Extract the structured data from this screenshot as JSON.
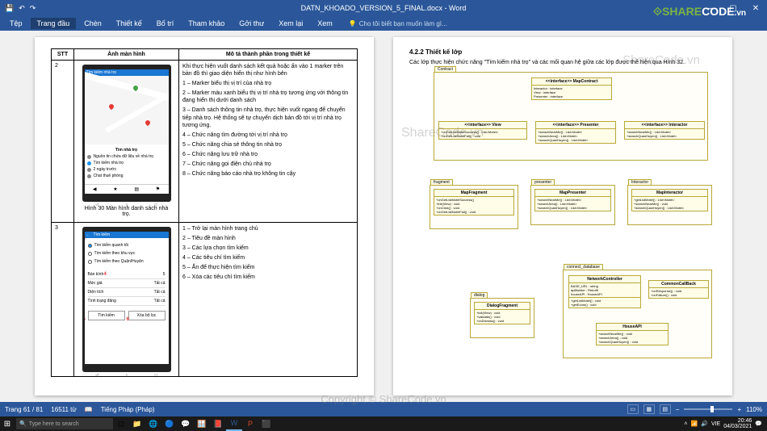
{
  "app": {
    "title": "DATN_KHOADO_VERSION_5_FINAL.docx - Word",
    "win_min": "—",
    "win_max": "▢",
    "win_close": "✕"
  },
  "ribbon": {
    "tabs": [
      "Tệp",
      "Trang đầu",
      "Chèn",
      "Thiết kế",
      "Bố trí",
      "Tham khảo",
      "Gởi thư",
      "Xem lại",
      "Xem"
    ],
    "tellme": "Cho tôi biết bạn muốn làm gì..."
  },
  "logo": {
    "share": "SHARE",
    "code": "CODE",
    "suffix": ".vn"
  },
  "watermarks": {
    "wm1": "ShareCode.vn",
    "wm2": "ShareCode.vn",
    "copyright": "Copyright © ShareCode.vn"
  },
  "page1": {
    "headers": {
      "stt": "STT",
      "img": "Ảnh màn hình",
      "desc": "Mô tả thành phần trong thiết kế"
    },
    "row2": {
      "stt": "2",
      "caption": "Hình 30 Màn hình danh sách nhà trọ.",
      "phone": {
        "topbar": "Tìm kiếm nhà trọ",
        "listTitle": "Tìm nhà trọ",
        "items": [
          "Nguồn tin chứa dữ liệu về nhà trọ",
          "Tìm kiếm nhà trọ",
          "2 ngày trước",
          "Chat thuê phòng"
        ],
        "icons": [
          "◀",
          "★",
          "▤",
          "⚑"
        ]
      },
      "desc": {
        "intro": "Khi thực hiện vuốt danh sách kết quả hoặc ấn vào 1 marker trên bản đồ thì giao diện hiển thị như hình bên",
        "p1": "1 – Marker biểu thị vị trí của nhà trọ",
        "p2": "2 – Marker màu xanh biểu thị vị trí nhà trọ tương ứng với thông tin đang hiển thị dưới danh sách",
        "p3": "3 – Danh sách thông tin nhà trọ, thực hiện vuốt ngang để chuyển tiếp nhà trọ. Hệ thống sẽ tự chuyển dịch bản đồ tới vị trí nhà trọ tương ứng.",
        "p4": "4 – Chức năng tìm đường tới vị trí nhà trọ",
        "p5": "5 – Chức năng chia sẻ thông tin nhà trọ",
        "p6": "6 – Chức năng lưu trữ nhà trọ",
        "p7": "7 – Chức năng gọi điện chủ nhà trọ",
        "p8": "8 – Chức năng báo cáo nhà trọ không tin cậy"
      }
    },
    "row3": {
      "stt": "3",
      "phone": {
        "topbar": "Tìm kiếm",
        "opt1": "Tìm kiếm quanh tôi",
        "opt2": "Tìm kiếm theo khu vực",
        "opt3": "Tìm kiếm theo Quận/Huyện",
        "f1l": "Bán kính",
        "f1v": "5",
        "f2l": "Mức giá",
        "f2v": "Tất cả",
        "f3l": "Diện tích",
        "f3v": "Tất cả",
        "f4l": "Tình trạng đăng",
        "f4v": "Tất cả",
        "btn1": "Tìm kiếm",
        "btn2": "Xóa bộ lọc"
      },
      "desc": {
        "p1": "1 – Trở lại màn hình trang chủ",
        "p2": "2 – Tiêu đề màn hình",
        "p3": "3 – Các lựa chọn tìm kiếm",
        "p4": "4 – Các tiêu chí tìm kiếm",
        "p5": "5 – Ấn để thực hiện tìm kiếm",
        "p6": "6 – Xóa các tiêu chí tìm kiếm"
      }
    }
  },
  "page2": {
    "sectionNum": "4.2.2 Thiết kế lớp",
    "body": "Các lớp thực hiện chức năng \"Tìm kiếm nhà trọ\" và các mối quan hệ giữa các lớp được thể hiện qua Hình 32.",
    "uml": {
      "contract": "Contract",
      "mapContract": {
        "title": "<<interface>> MapContract",
        "items": [
          "Interactor : interface",
          "View : interface",
          "Presenter : interface"
        ]
      },
      "view": {
        "title": "<<interface>> View",
        "items": [
          "+onGetListMotelSuccess() : List<Motel>",
          "+onGetListMotelFail() : void"
        ]
      },
      "presenter": {
        "title": "<<interface>> Presenter",
        "items": [
          "+searchNearMe() : List<Motel>",
          "+searchArea() : List<Motel>",
          "+searchQuanHuyen() : List<Motel>"
        ]
      },
      "interactor": {
        "title": "<<interface>> Interactor",
        "items": [
          "+searchNearMe() : List<Motel>",
          "+searchQuanHuyen() : List<Motel>"
        ]
      },
      "fragment": {
        "pkg": "fragment",
        "title": "MapFragment",
        "items": [
          "+onGetListMotelSuccess()",
          "+init(View) : void",
          "+onClick() : void",
          "+onGetListMotelFail() : void"
        ]
      },
      "pres": {
        "pkg": "presenter",
        "title": "MapPresenter",
        "items": [
          "+searchNearMe() : List<Motel>",
          "+searchArea() : List<Motel>",
          "+searchQuanHuyen() : List<Motel>"
        ]
      },
      "inter": {
        "pkg": "Interactor",
        "title": "MapInteractor",
        "items": [
          "+getListMotel() : List<Motel>",
          "+searchNearMe() : void",
          "+searchQuanHuyen() : List<Motel>"
        ]
      },
      "dialog": {
        "pkg": "dialog",
        "title": "DialogFragment",
        "items": [
          "+init(View) : void",
          "+validate() : void",
          "+onDismiss() : void"
        ]
      },
      "db": {
        "pkg": "connect_database",
        "nc": {
          "title": "NetworkController",
          "items": [
            "BASE_URL : string",
            "apiBuilder : Retrofit",
            "houseAPI : HouseAPI",
            "+getListMotel() : void",
            "+getEcom() : void"
          ]
        },
        "cb": {
          "title": "CommonCallBack",
          "items": [
            "+onResponse() : void",
            "+onFailure() : void"
          ]
        },
        "api": {
          "title": "HouseAPI",
          "items": [
            "+searchNearMe() : void",
            "+searchArea() : void",
            "+searchQuanHuyen() : void"
          ]
        }
      }
    }
  },
  "status": {
    "page": "Trang 61 / 81",
    "words": "16511 từ",
    "lang": "Tiếng Pháp (Pháp)",
    "zoom": "110%"
  },
  "taskbar": {
    "search": "Type here to search",
    "time": "20:46",
    "date": "04/03/2021",
    "lang": "VIE"
  }
}
